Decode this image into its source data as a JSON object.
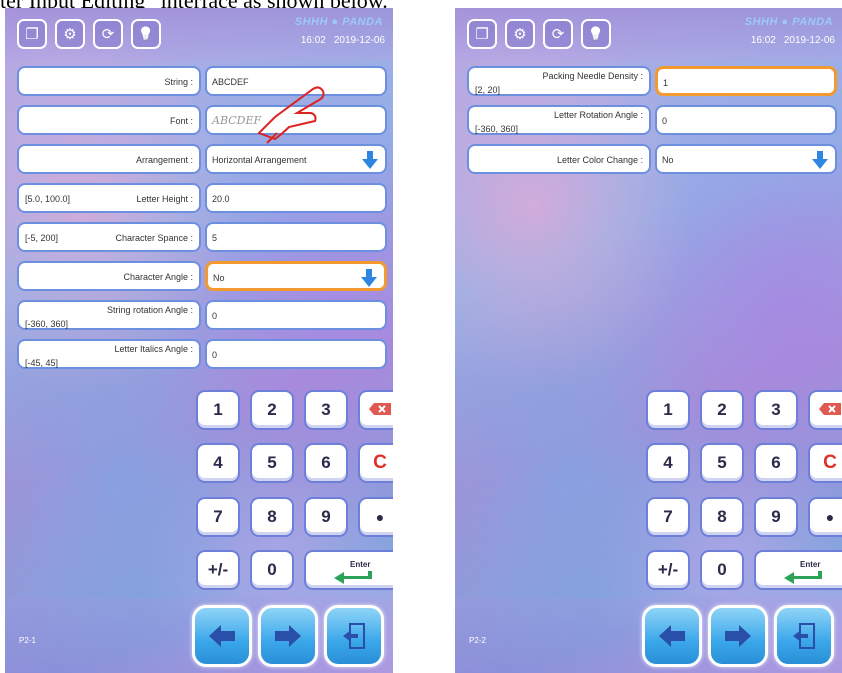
{
  "caption": "ter Input Editing” interface as shown below.",
  "colors": {
    "frame_border": "#6d8fe0",
    "selected_border": "#f29a30",
    "dropdown_arrow": "#2f86e0",
    "key_red": "#e0302a",
    "nav_blue": "#3aa7ea"
  },
  "screens": [
    {
      "topbar": {
        "icons": [
          "copy-icon",
          "tool-icon",
          "refresh-icon",
          "bulb-icon"
        ],
        "logo": "SHHH ● PANDA",
        "time": "16:02",
        "date": "2019-12-06"
      },
      "params": [
        {
          "label": "String :",
          "range": "",
          "value": "ABCDEF",
          "dropdown": false,
          "selected": false
        },
        {
          "label": "Font :",
          "range": "",
          "value": "ABCDEF",
          "dropdown": false,
          "selected": false
        },
        {
          "label": "Arrangement :",
          "range": "",
          "value": "Horizontal Arrangement",
          "dropdown": true,
          "selected": false
        },
        {
          "label": "Letter Height :",
          "range": "[5.0, 100.0]",
          "value": "20.0",
          "dropdown": false,
          "selected": false
        },
        {
          "label": "Character Spance :",
          "range": "[-5, 200]",
          "value": "5",
          "dropdown": false,
          "selected": false
        },
        {
          "label": "Character Angle :",
          "range": "",
          "value": "No",
          "dropdown": true,
          "selected": true
        },
        {
          "label": "String rotation Angle :",
          "range": "[-360, 360]",
          "value": "0",
          "dropdown": false,
          "selected": false
        },
        {
          "label": "Letter Italics Angle :",
          "range": "[-45, 45]",
          "value": "0",
          "dropdown": false,
          "selected": false
        }
      ],
      "keypad": [
        "1",
        "2",
        "3",
        "⌫",
        "4",
        "5",
        "6",
        "C",
        "7",
        "8",
        "9",
        "●",
        "+/-",
        "0",
        "Enter"
      ],
      "page_label": "P2-1",
      "nav": [
        "left-arrow-icon",
        "right-arrow-icon",
        "exit-icon"
      ]
    },
    {
      "topbar": {
        "icons": [
          "copy-icon",
          "tool-icon",
          "refresh-icon",
          "bulb-icon"
        ],
        "logo": "SHHH ● PANDA",
        "time": "16:02",
        "date": "2019-12-06"
      },
      "params": [
        {
          "label": "Packing Needle Density :",
          "range": "[2, 20]",
          "value": "1",
          "dropdown": false,
          "selected": true
        },
        {
          "label": "Letter Rotation Angle :",
          "range": "[-360, 360]",
          "value": "0",
          "dropdown": false,
          "selected": false
        },
        {
          "label": "Letter Color Change :",
          "range": "",
          "value": "No",
          "dropdown": true,
          "selected": false
        }
      ],
      "keypad": [
        "1",
        "2",
        "3",
        "⌫",
        "4",
        "5",
        "6",
        "C",
        "7",
        "8",
        "9",
        "●",
        "+/-",
        "0",
        "Enter"
      ],
      "page_label": "P2-2",
      "nav": [
        "left-arrow-icon",
        "right-arrow-icon",
        "exit-icon"
      ]
    }
  ]
}
